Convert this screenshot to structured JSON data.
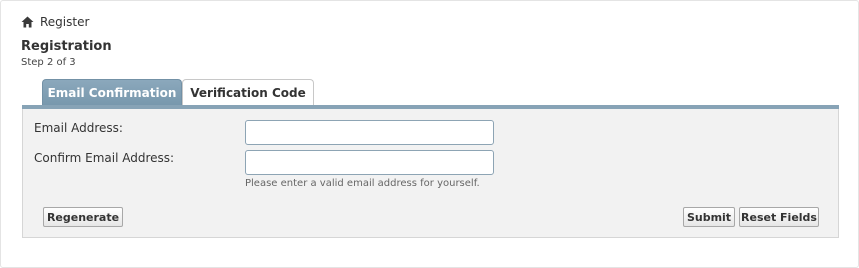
{
  "breadcrumb": {
    "icon": "home-icon",
    "label": "Register"
  },
  "page": {
    "title": "Registration",
    "step": "Step 2 of 3"
  },
  "tabs": [
    {
      "label": "Email Confirmation",
      "active": true
    },
    {
      "label": "Verification Code",
      "active": false
    }
  ],
  "form": {
    "email_label": "Email Address:",
    "email_value": "",
    "confirm_label": "Confirm Email Address:",
    "confirm_value": "",
    "hint": "Please enter a valid email address for yourself."
  },
  "buttons": {
    "regenerate": "Regenerate",
    "submit": "Submit",
    "reset": "Reset Fields"
  },
  "colors": {
    "active_tab": "#7898ad",
    "tab_bar": "#87a3b6",
    "panel_bg": "#f2f2f2"
  }
}
